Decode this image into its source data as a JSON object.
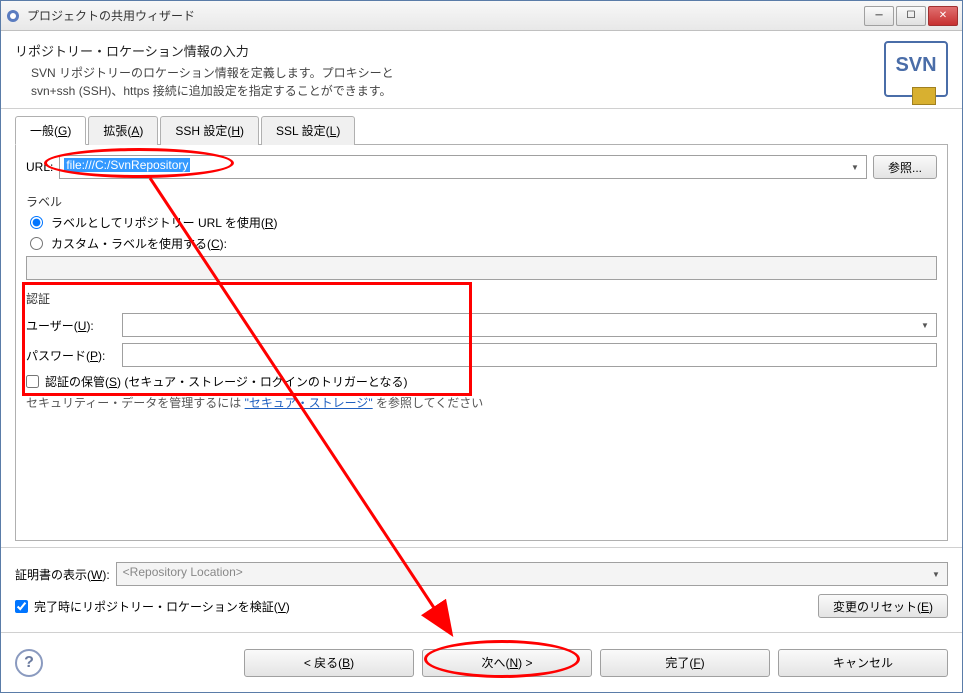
{
  "titlebar": {
    "title": "プロジェクトの共用ウィザード"
  },
  "header": {
    "title": "リポジトリー・ロケーション情報の入力",
    "desc1": "SVN リポジトリーのロケーション情報を定義します。プロキシーと",
    "desc2": "svn+ssh (SSH)、https 接続に追加設定を指定することができます。",
    "badge": "SVN"
  },
  "tabs": {
    "general": "一般(G)",
    "advanced": "拡張(A)",
    "ssh": "SSH 設定(H)",
    "ssl": "SSL 設定(L)"
  },
  "url": {
    "label": "URL:",
    "value": "file:///C:/SvnRepository",
    "browse": "参照..."
  },
  "label_group": {
    "title": "ラベル",
    "radio_url": "ラベルとしてリポジトリー URL を使用(R)",
    "radio_custom": "カスタム・ラベルを使用する(C):"
  },
  "auth": {
    "title": "認証",
    "user_label": "ユーザー(U):",
    "password_label": "パスワード(P):",
    "save_label": "認証の保管(S) (セキュア・ストレージ・ログインのトリガーとなる)",
    "sec_note_prefix": "セキュリティー・データを管理するには ",
    "sec_link": "\"セキュア・ストレージ\"",
    "sec_note_suffix": " を参照してください"
  },
  "cert": {
    "label": "証明書の表示(W):",
    "placeholder": "<Repository Location>"
  },
  "validate": {
    "label": "完了時にリポジトリー・ロケーションを検証(V)",
    "reset": "変更のリセット(E)"
  },
  "footer": {
    "back": "< 戻る(B)",
    "next": "次へ(N) >",
    "finish": "完了(F)",
    "cancel": "キャンセル"
  }
}
